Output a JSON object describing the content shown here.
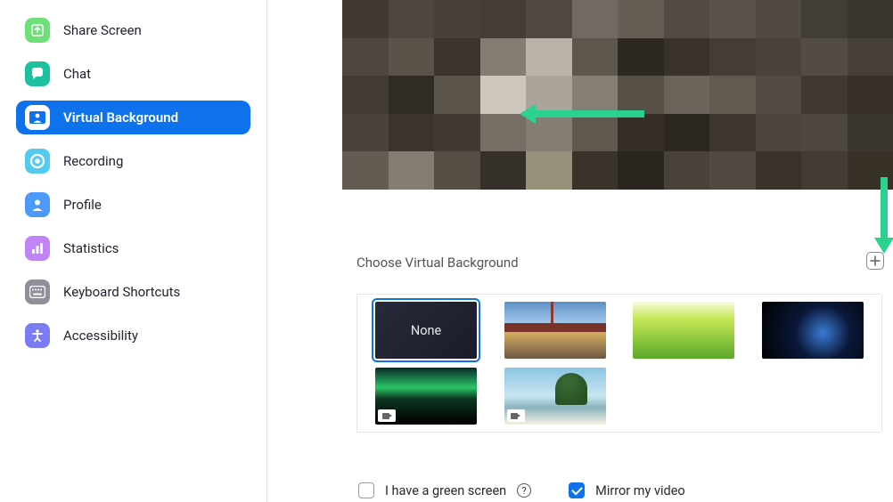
{
  "sidebar": {
    "items": [
      {
        "label": "Share Screen",
        "icon": "share-screen-icon",
        "active": false
      },
      {
        "label": "Chat",
        "icon": "chat-icon",
        "active": false
      },
      {
        "label": "Virtual Background",
        "icon": "virtual-background-icon",
        "active": true
      },
      {
        "label": "Recording",
        "icon": "recording-icon",
        "active": false
      },
      {
        "label": "Profile",
        "icon": "profile-icon",
        "active": false
      },
      {
        "label": "Statistics",
        "icon": "statistics-icon",
        "active": false
      },
      {
        "label": "Keyboard Shortcuts",
        "icon": "keyboard-icon",
        "active": false
      },
      {
        "label": "Accessibility",
        "icon": "accessibility-icon",
        "active": false
      }
    ]
  },
  "main": {
    "section_label": "Choose Virtual Background",
    "backgrounds": [
      {
        "name": "none",
        "label": "None",
        "selected": true,
        "video": false
      },
      {
        "name": "golden-gate-bridge",
        "label": "",
        "selected": false,
        "video": false
      },
      {
        "name": "grass",
        "label": "",
        "selected": false,
        "video": false
      },
      {
        "name": "earth-from-space",
        "label": "",
        "selected": false,
        "video": false
      },
      {
        "name": "aurora",
        "label": "",
        "selected": false,
        "video": true
      },
      {
        "name": "beach",
        "label": "",
        "selected": false,
        "video": true
      }
    ],
    "options": {
      "green_screen_label": "I have a green screen",
      "green_screen_checked": false,
      "mirror_label": "Mirror my video",
      "mirror_checked": true
    }
  },
  "colors": {
    "accent": "#0e72ed",
    "annotation_arrow": "#2ad18f"
  }
}
